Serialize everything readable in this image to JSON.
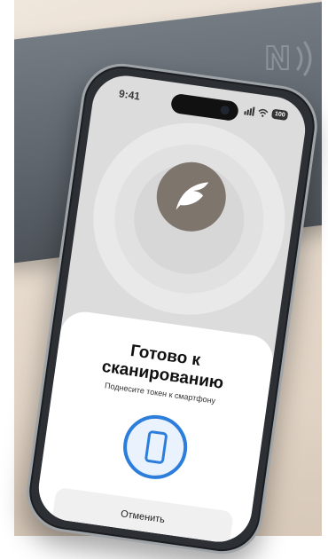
{
  "status_bar": {
    "time": "9:41",
    "battery": "100"
  },
  "sheet": {
    "title_line1": "Готово к",
    "title_line2": "сканированию",
    "subtitle": "Поднесите токен к смартфону",
    "cancel_label": "Отменить"
  },
  "colors": {
    "accent": "#2d7ddc",
    "card": "#5f666d",
    "logo_circle": "#7e756d",
    "sheet_bg": "#ffffff"
  },
  "icons": {
    "card": "nfc-icon",
    "app": "leaf-logo-icon",
    "scan": "smartphone-icon",
    "wifi": "wifi-icon",
    "signal": "signal-icon"
  }
}
